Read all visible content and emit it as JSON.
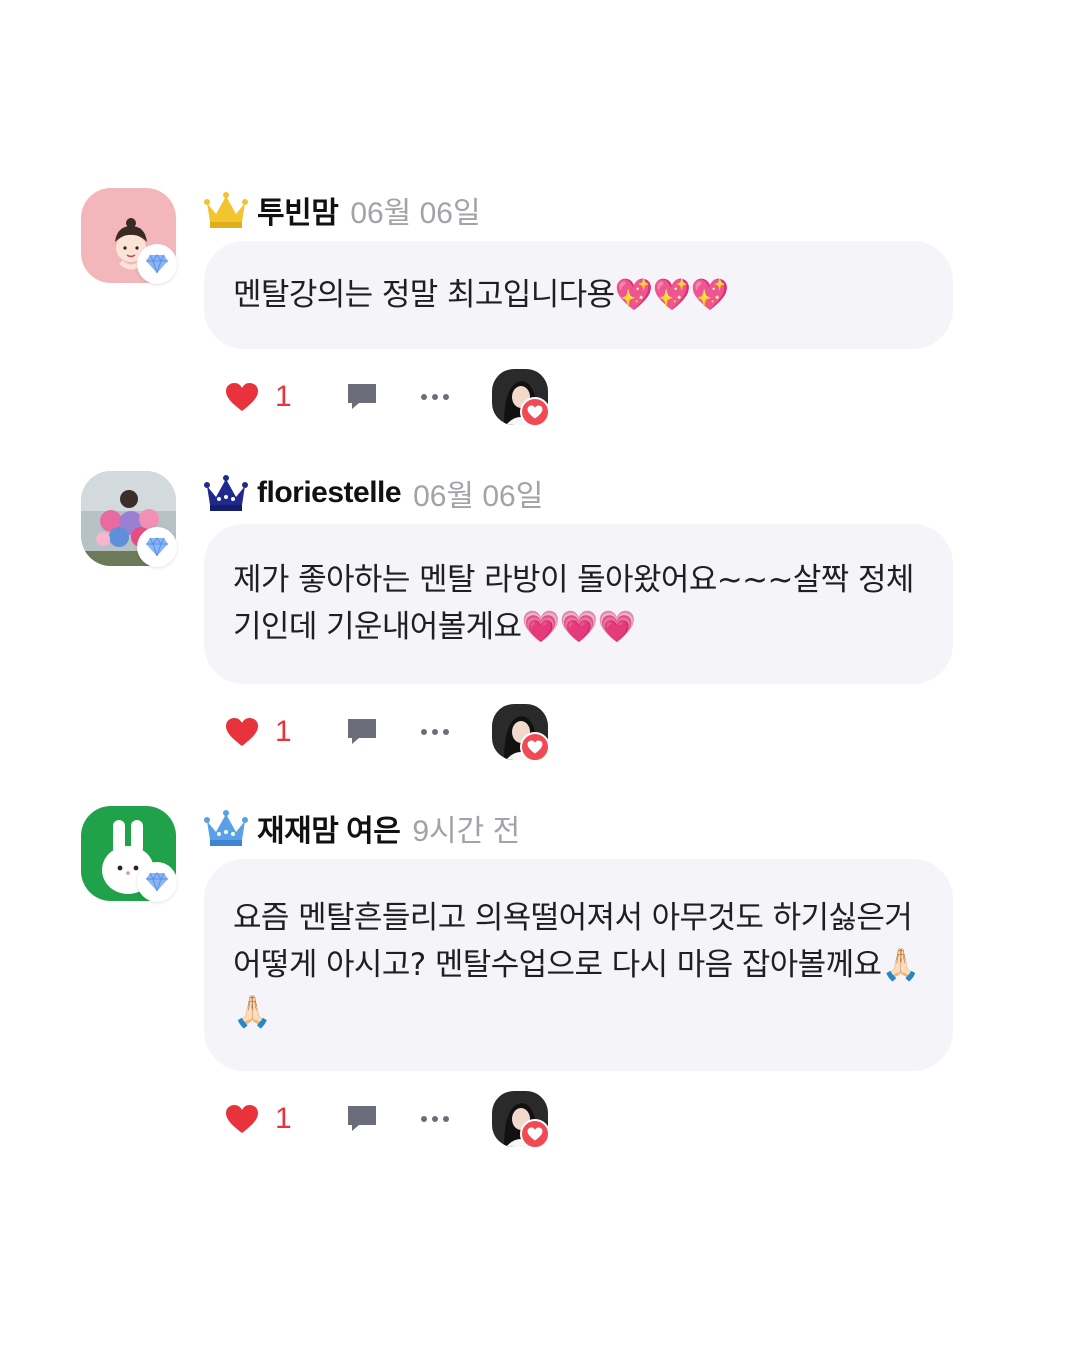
{
  "comments": [
    {
      "username": "투빈맘",
      "timestamp": "06월 06일",
      "text": "멘탈강의는 정말 최고입니다용💖💖💖",
      "likes": "1",
      "crown_color": "#f2c530"
    },
    {
      "username": "floriestelle",
      "timestamp": "06월 06일",
      "text": "제가 좋아하는 멘탈 라방이 돌아왔어요~~~살짝 정체기인데 기운내어볼게요💗💗💗",
      "likes": "1",
      "crown_color": "#1f2a8c"
    },
    {
      "username": "재재맘 여은",
      "timestamp": "9시간 전",
      "text": "요즘 멘탈흔들리고 의욕떨어져서 아무것도 하기싫은거 어떻게 아시고? 멘탈수업으로 다시 마음 잡아볼께요🙏🏻🙏🏻",
      "likes": "1",
      "crown_color": "#5aa0e6"
    }
  ],
  "colors": {
    "bubble_background": "#f5f5f9",
    "like_red": "#e8323c",
    "timestamp_gray": "#a2a2a8",
    "icon_gray": "#6b6e7a"
  },
  "icons": {
    "badge": "diamond-icon",
    "like": "heart-icon",
    "reply": "speech-bubble-icon",
    "more": "ellipsis-icon",
    "rank": "crown-icon"
  }
}
